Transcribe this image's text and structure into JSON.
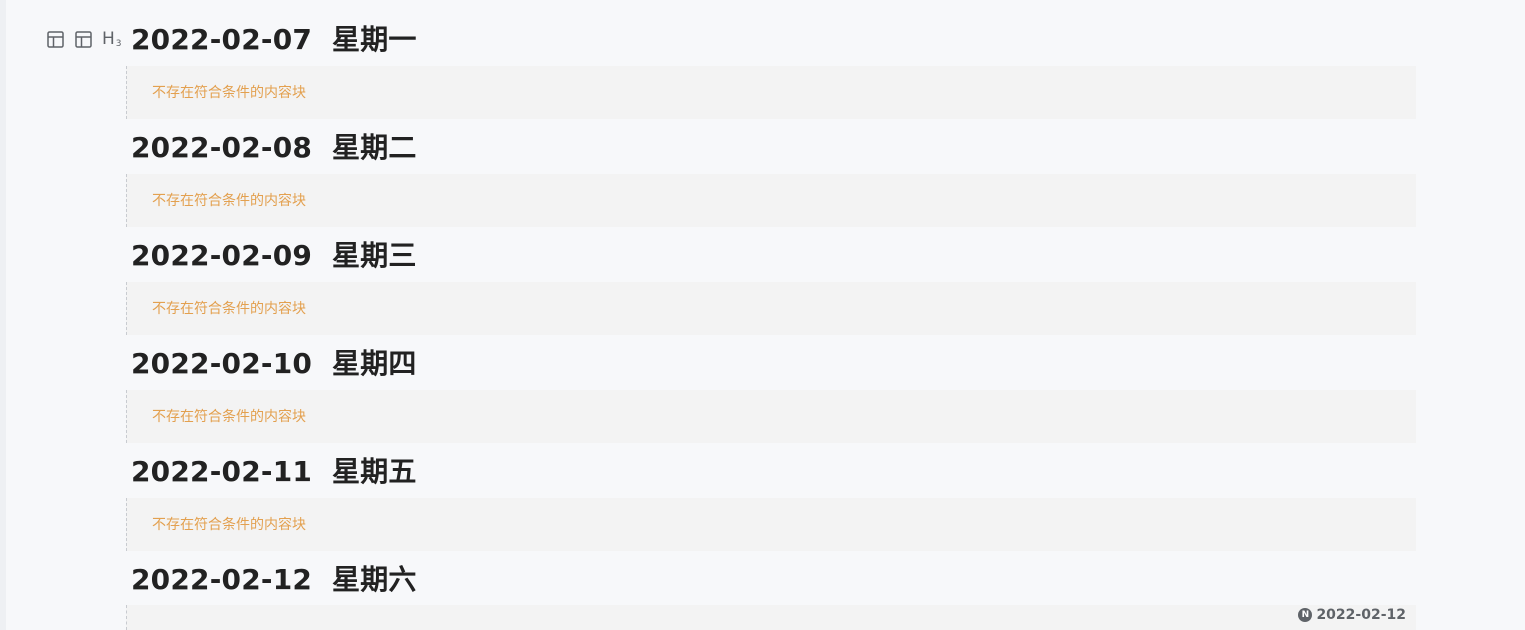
{
  "gutter": {
    "icons": [
      "layout-icon",
      "layout-icon",
      "heading-3-icon"
    ],
    "heading_label": "H",
    "heading_level": "3"
  },
  "days": [
    {
      "title": "2022-02-07  星期一",
      "empty_text": "不存在符合条件的内容块"
    },
    {
      "title": "2022-02-08  星期二",
      "empty_text": "不存在符合条件的内容块"
    },
    {
      "title": "2022-02-09  星期三",
      "empty_text": "不存在符合条件的内容块"
    },
    {
      "title": "2022-02-10  星期四",
      "empty_text": "不存在符合条件的内容块"
    },
    {
      "title": "2022-02-11  星期五",
      "empty_text": "不存在符合条件的内容块"
    },
    {
      "title": "2022-02-12  星期六",
      "empty_text": ""
    }
  ],
  "date_badge": {
    "icon": "N",
    "date": "2022-02-12"
  },
  "colors": {
    "background": "#f7f8fa",
    "embed_background": "#f3f3f3",
    "empty_text": "#e3a04f",
    "title": "#222222",
    "icon": "#5f6368"
  }
}
